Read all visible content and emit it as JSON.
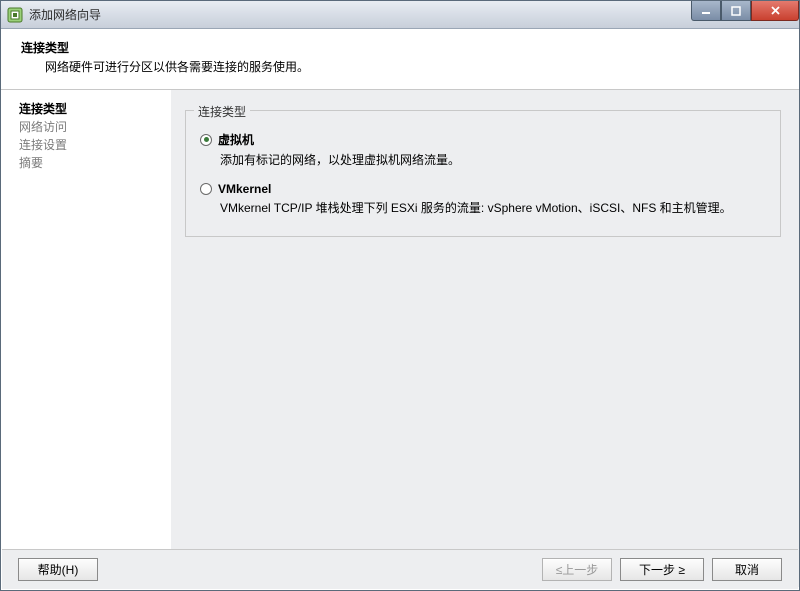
{
  "window": {
    "title": "添加网络向导"
  },
  "header": {
    "title": "连接类型",
    "subtitle": "网络硬件可进行分区以供各需要连接的服务使用。"
  },
  "sidebar": {
    "items": [
      {
        "label": "连接类型",
        "current": true
      },
      {
        "label": "网络访问",
        "current": false
      },
      {
        "label": "连接设置",
        "current": false
      },
      {
        "label": "摘要",
        "current": false
      }
    ]
  },
  "group": {
    "legend": "连接类型",
    "options": [
      {
        "label": "虚拟机",
        "desc": "添加有标记的网络，以处理虚拟机网络流量。",
        "checked": true
      },
      {
        "label": "VMkernel",
        "desc": "VMkernel TCP/IP 堆栈处理下列 ESXi 服务的流量: vSphere vMotion、iSCSI、NFS 和主机管理。",
        "checked": false
      }
    ]
  },
  "buttons": {
    "help": "帮助(H)",
    "back": "≤上一步",
    "next": "下一步 ≥",
    "cancel": "取消"
  }
}
